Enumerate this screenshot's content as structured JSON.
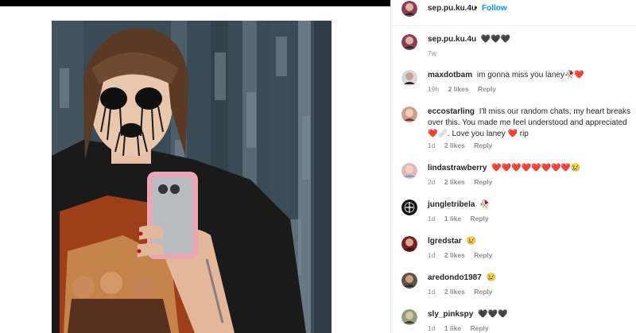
{
  "header": {
    "username": "sep.pu.ku.4u",
    "separator": "•",
    "follow_label": "Follow"
  },
  "caption": {
    "username": "sep.pu.ku.4u",
    "text": "🖤🖤🖤",
    "time": "7w"
  },
  "comments": [
    {
      "username": "maxdotbam",
      "text": "im gonna miss you laney🥀❤️",
      "time": "19h",
      "likes": "2 likes",
      "reply": "Reply"
    },
    {
      "username": "eccostarling",
      "text": "I'll miss our random chats, my heart breaks over this. You made me feel understood and appreciated ❤️🩹. Love you laney ❤️ rip",
      "time": "1d",
      "likes": "2 likes",
      "reply": "Reply"
    },
    {
      "username": "lindastrawberry",
      "text": "❤️❤️❤️❤️❤️❤️❤️❤️😢",
      "time": "2d",
      "likes": "2 likes",
      "reply": "Reply"
    },
    {
      "username": "jungletribela",
      "text": "🥀",
      "time": "1d",
      "likes": "1 like",
      "reply": "Reply"
    },
    {
      "username": "lgredstar",
      "text": "😢",
      "time": "1d",
      "likes": "2 likes",
      "reply": "Reply"
    },
    {
      "username": "aredondo1987",
      "text": "😢",
      "time": "1d",
      "likes": "2 likes",
      "reply": "Reply"
    },
    {
      "username": "sly_pinkspy",
      "text": "🖤🖤🖤",
      "time": "1d",
      "likes": "1 like",
      "reply": "Reply"
    }
  ],
  "colors": {
    "follow": "#0095f6",
    "text": "#262626",
    "muted": "#8e8e8e",
    "topbar": "#000000"
  },
  "icons": [
    "profile-avatar"
  ]
}
